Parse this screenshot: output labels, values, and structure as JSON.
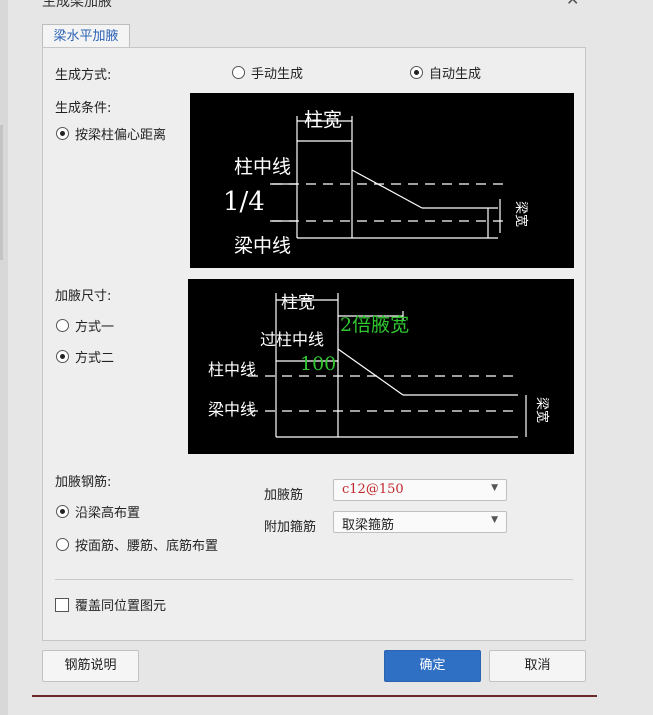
{
  "title_partial": "生成梁加腋",
  "tab": {
    "label": "梁水平加腋"
  },
  "gen_method": {
    "label": "生成方式:",
    "options": [
      {
        "label": "手动生成",
        "selected": false
      },
      {
        "label": "自动生成",
        "selected": true
      }
    ]
  },
  "gen_condition": {
    "label": "生成条件:",
    "option": {
      "label": "按梁柱偏心距离",
      "selected": true
    }
  },
  "diagram1": {
    "col_width": "柱宽",
    "col_center": "柱中线",
    "ratio": "1/4",
    "beam_center": "梁中线",
    "beam_width": "梁宽"
  },
  "haunch_size": {
    "label": "加腋尺寸:",
    "options": [
      {
        "label": "方式一",
        "selected": false
      },
      {
        "label": "方式二",
        "selected": true
      }
    ]
  },
  "diagram2": {
    "col_width": "柱宽",
    "cross_col_center": "过柱中线",
    "double_width": "2倍腋宽",
    "offset": "100",
    "col_center": "柱中线",
    "beam_center": "梁中线",
    "beam_width": "梁宽"
  },
  "rebar": {
    "label": "加腋钢筋:",
    "options": [
      {
        "label": "沿梁高布置",
        "selected": true
      },
      {
        "label": "按面筋、腰筋、底筋布置",
        "selected": false
      }
    ],
    "haunch_rebar_label": "加腋筋",
    "haunch_rebar_value": "c12@150",
    "stirrup_label": "附加箍筋",
    "stirrup_value": "取梁箍筋"
  },
  "overwrite": {
    "label": "覆盖同位置图元",
    "checked": false
  },
  "buttons": {
    "rebar_info": "钢筋说明",
    "ok": "确定",
    "cancel": "取消"
  },
  "colors": {
    "accent": "#2f6fc4",
    "rebar_value": "#c0282d",
    "diagram_green": "#2fc62f"
  }
}
